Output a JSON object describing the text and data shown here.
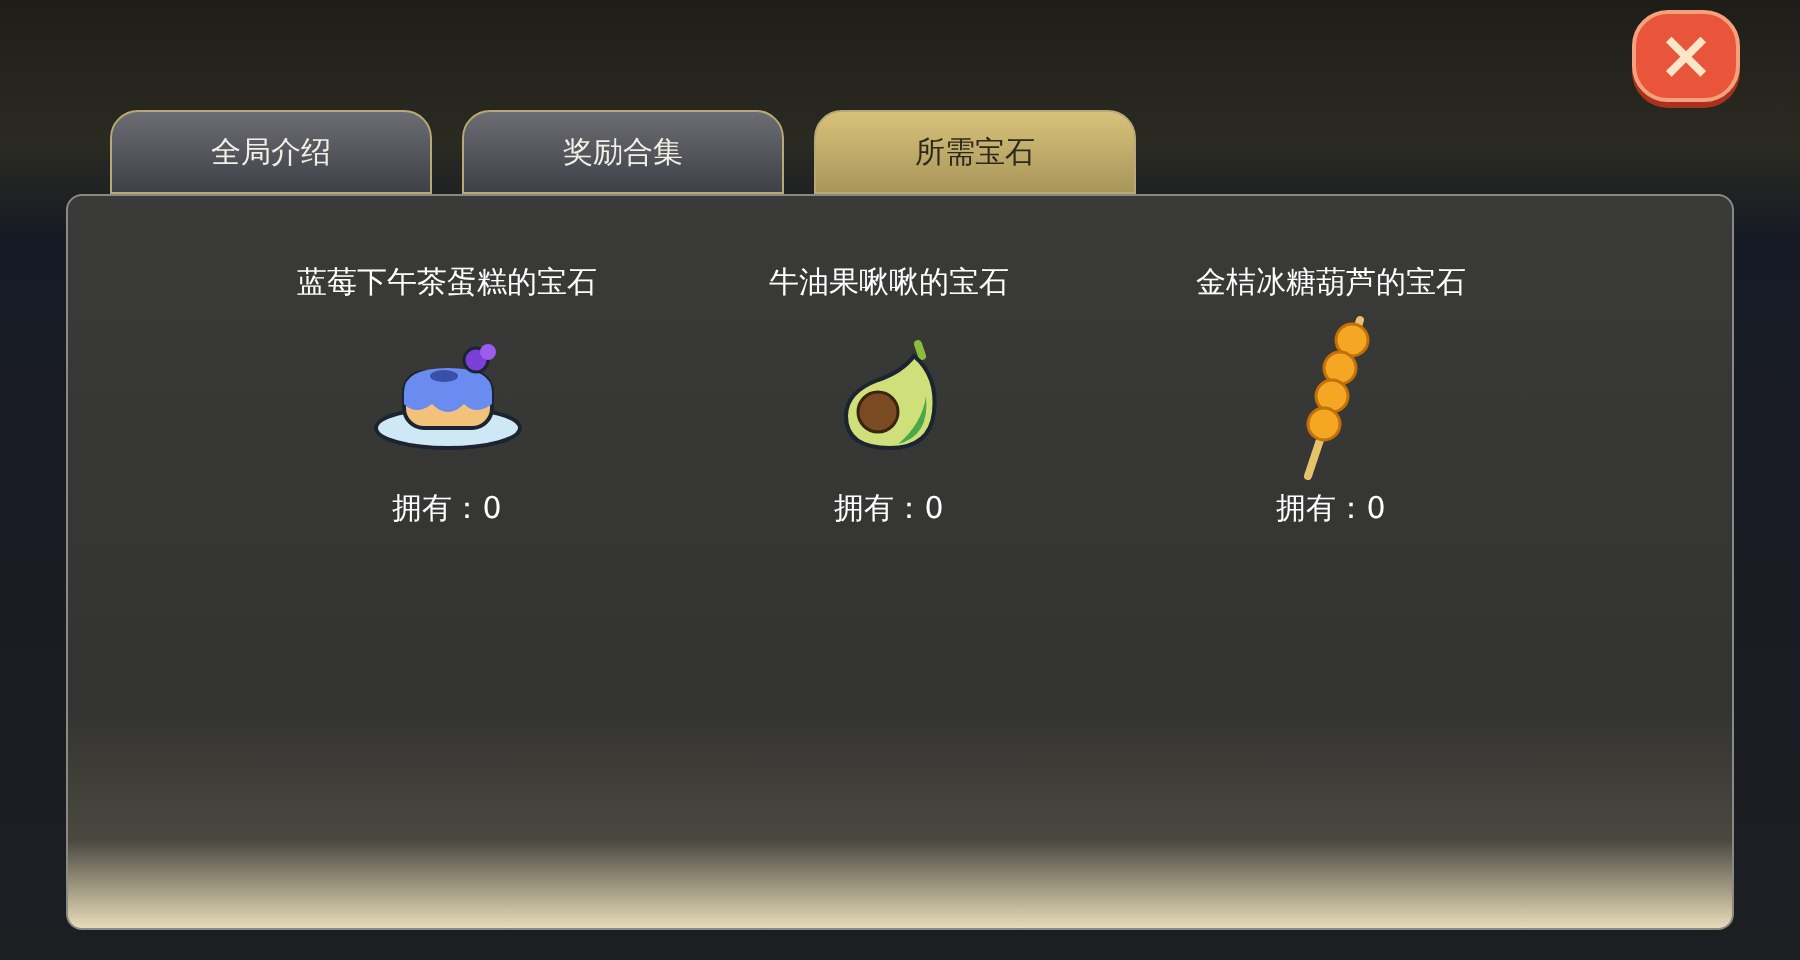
{
  "close_button": {
    "label": "×"
  },
  "tabs": [
    {
      "label": "全局介绍",
      "selected": false
    },
    {
      "label": "奖励合集",
      "selected": false
    },
    {
      "label": "所需宝石",
      "selected": true
    }
  ],
  "gems": [
    {
      "kind": "cake",
      "name": "蓝莓下午茶蛋糕的宝石",
      "owned": "拥有：0"
    },
    {
      "kind": "avocado",
      "name": "牛油果啾啾的宝石",
      "owned": "拥有：0"
    },
    {
      "kind": "skewer",
      "name": "金桔冰糖葫芦的宝石",
      "owned": "拥有：0"
    }
  ]
}
